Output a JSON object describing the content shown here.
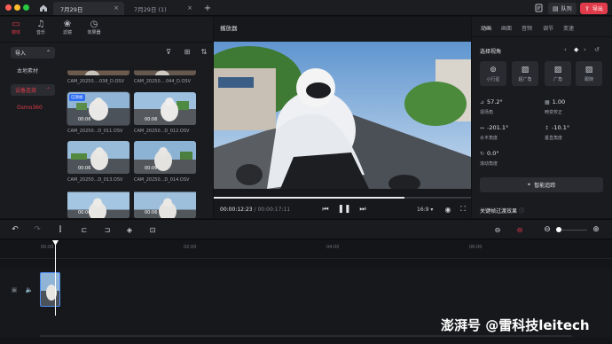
{
  "tabs": [
    {
      "label": "7月29日",
      "active": true
    },
    {
      "label": "7月29日 (1)",
      "active": false
    }
  ],
  "titlebar": {
    "queue_label": "队列",
    "export_label": "导出"
  },
  "colors": {
    "accent": "#e03b4a",
    "bg": "#111214",
    "panel": "#1a1b1f"
  },
  "toolbar_icons": [
    {
      "label": "媒体",
      "icon": "folder-icon"
    },
    {
      "label": "音乐",
      "icon": "music-icon"
    },
    {
      "label": "滤镜",
      "icon": "filter-icon"
    },
    {
      "label": "效果器",
      "icon": "effects-icon"
    }
  ],
  "sidebar": {
    "import_label": "导入",
    "local_label": "本地素材",
    "device_label": "设备连接",
    "device_name": "Osmo360"
  },
  "media": [
    {
      "name": "CAM_20250....038_D.OSV",
      "duration": ""
    },
    {
      "name": "CAM_20250....044_D.OSV",
      "duration": ""
    },
    {
      "name": "CAM_20250...D_011.OSV",
      "duration": "00:06",
      "badge": "已添加"
    },
    {
      "name": "CAM_20250...D_012.OSV",
      "duration": "00:06"
    },
    {
      "name": "CAM_20250...D_013.OSV",
      "duration": "00:06"
    },
    {
      "name": "CAM_20250...D_014.OSV",
      "duration": "00:06"
    },
    {
      "name": "",
      "duration": "00:06"
    },
    {
      "name": "",
      "duration": "00:06"
    }
  ],
  "player": {
    "title": "播放器",
    "current_time": "00:00:12:23",
    "total_time": "00:00:17:11",
    "aspect": "16:9",
    "progress": 0.74
  },
  "right_panel": {
    "tabs": [
      "动画",
      "画面",
      "音频",
      "调节",
      "变速"
    ],
    "section_title": "选择视角",
    "views": [
      "小行星",
      "超广角",
      "广角",
      "跟随"
    ],
    "params": [
      {
        "label": "视场角",
        "value": "57.2°"
      },
      {
        "label": "畸变校正",
        "value": "1.00"
      },
      {
        "label": "水平角度",
        "value": "-201.1°"
      },
      {
        "label": "垂直角度",
        "value": "-10.1°"
      },
      {
        "label": "滚动角度",
        "value": "0.0°"
      }
    ],
    "smart_track_label": "智能追踪",
    "keyframe_label": "关键帧过渡效果"
  },
  "timeline": {
    "ticks": [
      "00:00",
      "02:00",
      "04:00",
      "06:00"
    ]
  },
  "watermark": "澎湃号 @雷科技leitech"
}
